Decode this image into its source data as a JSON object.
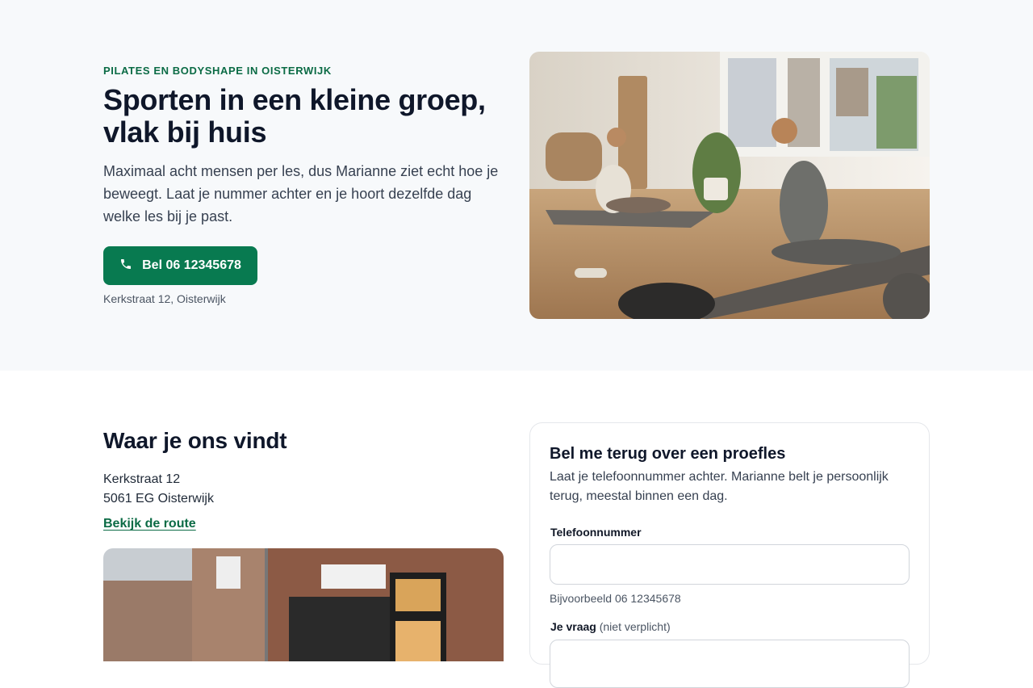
{
  "hero": {
    "eyebrow": "PILATES EN BODYSHAPE IN OISTERWIJK",
    "title": "Sporten in een kleine groep, vlak bij huis",
    "text": "Maximaal acht mensen per les, dus Marianne ziet echt hoe je beweegt. Laat je nummer achter en je hoort dezelfde dag welke les bij je past.",
    "call_button": "Bel 06 12345678",
    "address": "Kerkstraat 12, Oisterwijk",
    "image_icon": "pilates-studio-photo"
  },
  "location": {
    "title": "Waar je ons vindt",
    "street": "Kerkstraat 12",
    "city": "5061 EG Oisterwijk",
    "route_link": "Bekijk de route",
    "image_icon": "studio-storefront-photo"
  },
  "callback_form": {
    "title": "Bel me terug over een proefles",
    "text": "Laat je telefoonnummer achter. Marianne belt je persoonlijk terug, meestal binnen een dag.",
    "phone_label": "Telefoonnummer",
    "phone_value": "",
    "phone_hint": "Bijvoorbeeld 06 12345678",
    "question_label": "Je vraag",
    "question_optional": "(niet verplicht)"
  },
  "colors": {
    "accent": "#087a50",
    "eyebrow": "#0b6b45",
    "hero_bg": "#f7f9fb"
  }
}
